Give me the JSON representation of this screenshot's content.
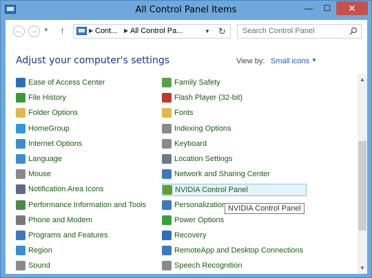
{
  "window": {
    "title": "All Control Panel Items",
    "minimize_glyph": "—",
    "maximize_glyph": "☐",
    "close_glyph": "✕"
  },
  "address": {
    "segment1": "Cont...",
    "segment2": "All Control Pa...",
    "sep": "▶"
  },
  "search": {
    "placeholder": "Search Control Panel"
  },
  "header": {
    "title": "Adjust your computer's settings",
    "view_by_label": "View by:",
    "view_by_value": "Small icons"
  },
  "items_left": [
    {
      "label": "Ease of Access Center",
      "icon": "ease-of-access-icon",
      "color": "#2d6fbf"
    },
    {
      "label": "File History",
      "icon": "file-history-icon",
      "color": "#3a9a3a"
    },
    {
      "label": "Folder Options",
      "icon": "folder-icon",
      "color": "#e3b84a"
    },
    {
      "label": "HomeGroup",
      "icon": "homegroup-icon",
      "color": "#2f9ad8"
    },
    {
      "label": "Internet Options",
      "icon": "internet-icon",
      "color": "#3a8fd0"
    },
    {
      "label": "Language",
      "icon": "language-icon",
      "color": "#3a8fd0"
    },
    {
      "label": "Mouse",
      "icon": "mouse-icon",
      "color": "#8a8a8a"
    },
    {
      "label": "Notification Area Icons",
      "icon": "notification-icon",
      "color": "#5a6e8a"
    },
    {
      "label": "Performance Information and Tools",
      "icon": "performance-icon",
      "color": "#4b8a4b"
    },
    {
      "label": "Phone and Modem",
      "icon": "phone-icon",
      "color": "#7a7a7a"
    },
    {
      "label": "Programs and Features",
      "icon": "programs-icon",
      "color": "#3a7abf"
    },
    {
      "label": "Region",
      "icon": "region-icon",
      "color": "#3a8fd0"
    },
    {
      "label": "Sound",
      "icon": "sound-icon",
      "color": "#8a8a8a"
    }
  ],
  "items_right": [
    {
      "label": "Family Safety",
      "icon": "family-safety-icon",
      "color": "#5aa04a"
    },
    {
      "label": "Flash Player (32-bit)",
      "icon": "flash-icon",
      "color": "#c0392b"
    },
    {
      "label": "Fonts",
      "icon": "fonts-icon",
      "color": "#e3b84a"
    },
    {
      "label": "Indexing Options",
      "icon": "indexing-icon",
      "color": "#8a8a8a"
    },
    {
      "label": "Keyboard",
      "icon": "keyboard-icon",
      "color": "#8a8a8a"
    },
    {
      "label": "Location Settings",
      "icon": "location-icon",
      "color": "#6a7a8a"
    },
    {
      "label": "Network and Sharing Center",
      "icon": "network-icon",
      "color": "#3a7abf"
    },
    {
      "label": "NVIDIA Control Panel",
      "icon": "nvidia-icon",
      "color": "#5fa02a"
    },
    {
      "label": "Personalization",
      "icon": "personalization-icon",
      "color": "#3a7abf"
    },
    {
      "label": "Power Options",
      "icon": "power-icon",
      "color": "#3aa03a"
    },
    {
      "label": "Recovery",
      "icon": "recovery-icon",
      "color": "#2d6fbf"
    },
    {
      "label": "RemoteApp and Desktop Connections",
      "icon": "remoteapp-icon",
      "color": "#3a7abf"
    },
    {
      "label": "Speech Recognition",
      "icon": "speech-icon",
      "color": "#8a8a8a"
    }
  ],
  "tooltip": "NVIDIA Control Panel",
  "colors": {
    "link_green": "#1c5a14",
    "heading_blue": "#1e3287",
    "accent_blue": "#1e57c5",
    "selection": "#e5f3fb"
  }
}
